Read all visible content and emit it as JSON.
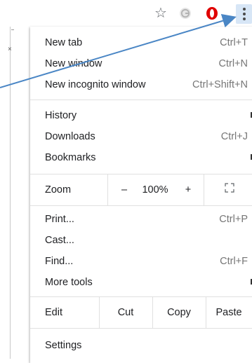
{
  "toolbar": {
    "bookmark_icon": "star-icon",
    "ext1_icon": "grammarly-icon",
    "ext2_icon": "opera-icon",
    "menu_icon": "kebab-menu-icon",
    "colors": {
      "menu_highlight": "#d7e6f6",
      "opera_red": "#e00000",
      "arrow": "#4a86c5"
    }
  },
  "menu": {
    "group1": [
      {
        "label": "New tab",
        "shortcut": "Ctrl+T"
      },
      {
        "label": "New window",
        "shortcut": "Ctrl+N"
      },
      {
        "label": "New incognito window",
        "shortcut": "Ctrl+Shift+N"
      }
    ],
    "group2": [
      {
        "label": "History",
        "shortcut": ""
      },
      {
        "label": "Downloads",
        "shortcut": "Ctrl+J"
      },
      {
        "label": "Bookmarks",
        "shortcut": ""
      }
    ],
    "zoom": {
      "label": "Zoom",
      "minus": "–",
      "level": "100%",
      "plus": "+"
    },
    "group3": [
      {
        "label": "Print...",
        "shortcut": "Ctrl+P"
      },
      {
        "label": "Cast...",
        "shortcut": ""
      },
      {
        "label": "Find...",
        "shortcut": "Ctrl+F"
      },
      {
        "label": "More tools",
        "shortcut": ""
      }
    ],
    "edit": {
      "label": "Edit",
      "cut": "Cut",
      "copy": "Copy",
      "paste": "Paste"
    },
    "settings": {
      "label": "Settings"
    }
  }
}
